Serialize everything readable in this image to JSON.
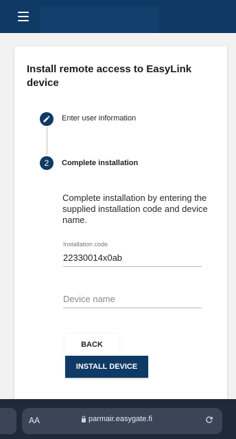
{
  "header": {
    "menu_icon": "hamburger-menu-icon",
    "colors": {
      "primary": "#0f3a66"
    }
  },
  "card": {
    "title": "Install remote access to EasyLink device",
    "steps": [
      {
        "icon": "edit-pencil-icon",
        "label": "Enter user information",
        "state": "completed"
      },
      {
        "number": "2",
        "label": "Complete installation",
        "state": "active"
      }
    ],
    "description": "Complete installation by entering the supplied installation code and device name.",
    "installation_code": {
      "label": "Installation code",
      "value": "22330014x0ab"
    },
    "device_name": {
      "placeholder": "Device name",
      "value": ""
    },
    "back_label": "BACK",
    "install_label": "INSTALL DEVICE"
  },
  "browser": {
    "text_size_label": "AA",
    "url": "parmair.easygate.fi",
    "lock_icon": "lock-icon",
    "reload_icon": "reload-icon"
  }
}
